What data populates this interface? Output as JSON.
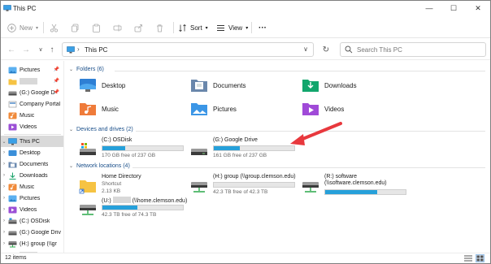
{
  "window": {
    "title": "This PC",
    "minimize_glyph": "—",
    "maximize_glyph": "☐",
    "close_glyph": "✕"
  },
  "commandbar": {
    "new_label": "New",
    "sort_label": "Sort",
    "view_label": "View",
    "more_glyph": "···"
  },
  "address": {
    "crumb": "This PC",
    "search_placeholder": "Search This PC"
  },
  "sidebar": {
    "pinned": [
      {
        "label": "Pictures",
        "icon": "pictures-icon",
        "pinned": true
      },
      {
        "label": "",
        "icon": "folder-yellow-icon",
        "pinned": true,
        "redacted": true
      },
      {
        "label": "(G:) Google D",
        "icon": "drive-icon",
        "pinned": true
      },
      {
        "label": "Company Portal",
        "icon": "company-portal-icon",
        "pinned": false
      },
      {
        "label": "Music",
        "icon": "music-icon",
        "pinned": false
      },
      {
        "label": "Videos",
        "icon": "videos-icon",
        "pinned": false
      }
    ],
    "this_pc": {
      "label": "This PC"
    },
    "children": [
      {
        "label": "Desktop",
        "icon": "desktop-icon"
      },
      {
        "label": "Documents",
        "icon": "documents-icon"
      },
      {
        "label": "Downloads",
        "icon": "downloads-icon"
      },
      {
        "label": "Music",
        "icon": "music-icon"
      },
      {
        "label": "Pictures",
        "icon": "pictures-icon"
      },
      {
        "label": "Videos",
        "icon": "videos-icon"
      },
      {
        "label": "(C:) OSDisk",
        "icon": "os-drive-icon"
      },
      {
        "label": "(G:) Google Driv",
        "icon": "drive-icon"
      },
      {
        "label": "(H:) group (\\\\gr",
        "icon": "network-drive-icon"
      },
      {
        "label": "",
        "icon": "network-drive-icon",
        "redacted": true
      }
    ]
  },
  "content": {
    "folders_header": "Folders (6)",
    "folders": [
      {
        "name": "Desktop",
        "icon": "desktop-icon"
      },
      {
        "name": "Documents",
        "icon": "documents-icon"
      },
      {
        "name": "Downloads",
        "icon": "downloads-icon"
      },
      {
        "name": "Music",
        "icon": "music-icon"
      },
      {
        "name": "Pictures",
        "icon": "pictures-icon"
      },
      {
        "name": "Videos",
        "icon": "videos-icon"
      }
    ],
    "drives_header": "Devices and drives (2)",
    "drives": [
      {
        "name": "(C:) OSDisk",
        "free": "170 GB free of 237 GB",
        "used_fraction": 0.28,
        "icon": "os-drive-icon"
      },
      {
        "name": "(G:) Google Drive",
        "free": "161 GB free of 237 GB",
        "used_fraction": 0.32,
        "icon": "drive-icon"
      }
    ],
    "network_header": "Network locations (4)",
    "network": [
      {
        "name": "Home Directory",
        "sub1": "Shortcut",
        "sub2": "2.13 KB",
        "icon": "shortcut-folder-icon"
      },
      {
        "name": "(H:) group (\\\\group.clemson.edu)",
        "free": "42.3 TB free of 42.3 TB",
        "used_fraction": 0.0,
        "icon": "network-drive-icon"
      },
      {
        "name": "(R:) software (\\\\software.clemson.edu)",
        "free": "42.3 TB free of 42.3 TB",
        "used_fraction": 0.65,
        "icon": "network-drive-icon"
      },
      {
        "name_prefix": "(U:)",
        "name_suffix": "(\\\\home.clemson.edu)",
        "free": "42.3 TB free of 74.3 TB",
        "used_fraction": 0.43,
        "icon": "network-drive-icon"
      }
    ]
  },
  "statusbar": {
    "count": "12 items"
  },
  "colors": {
    "accent": "#26a0da",
    "annotation_arrow": "#e8383d",
    "selected": "#d9d9d9"
  }
}
